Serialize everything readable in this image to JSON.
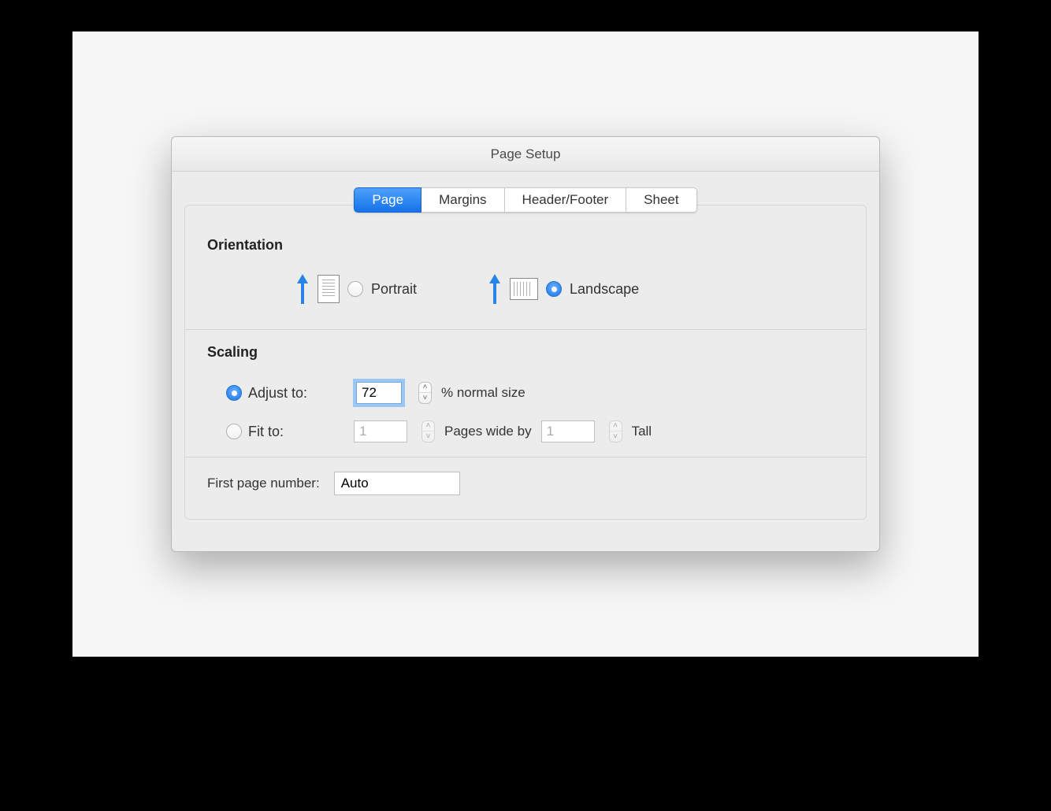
{
  "dialog": {
    "title": "Page Setup",
    "tabs": [
      "Page",
      "Margins",
      "Header/Footer",
      "Sheet"
    ],
    "activeTab": 0
  },
  "orientation": {
    "title": "Orientation",
    "portraitLabel": "Portrait",
    "landscapeLabel": "Landscape",
    "selected": "landscape"
  },
  "scaling": {
    "title": "Scaling",
    "adjustLabel": "Adjust to:",
    "adjustValue": "72",
    "adjustSuffix": "% normal size",
    "fitLabel": "Fit to:",
    "fitWide": "1",
    "fitMiddle": "Pages wide by",
    "fitTall": "1",
    "fitTallLabel": "Tall",
    "selected": "adjust"
  },
  "firstPage": {
    "label": "First page number:",
    "value": "Auto"
  }
}
